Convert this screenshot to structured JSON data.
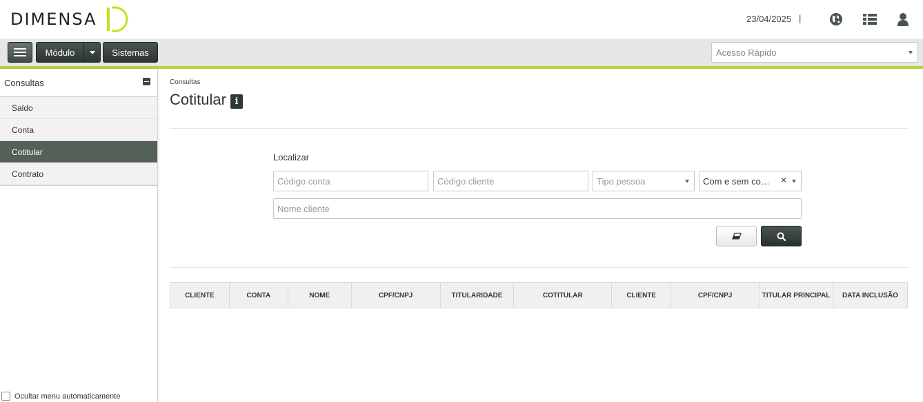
{
  "header": {
    "brand": "Dimensa",
    "date": "23/04/2025",
    "separator": "|",
    "icons": [
      "globe-icon",
      "list-icon",
      "user-icon"
    ]
  },
  "toolbar": {
    "modulo_label": "Módulo",
    "sistemas_label": "Sistemas",
    "acesso_placeholder": "Acesso Rápido"
  },
  "sidebar": {
    "title": "Consultas",
    "items": [
      {
        "label": "Saldo",
        "active": false
      },
      {
        "label": "Conta",
        "active": false
      },
      {
        "label": "Cotitular",
        "active": true
      },
      {
        "label": "Contrato",
        "active": false
      }
    ],
    "footer_label": "Ocultar menu automaticamente"
  },
  "main": {
    "breadcrumb": "Consultas",
    "title": "Cotitular",
    "localizar_label": "Localizar",
    "fields": {
      "codigo_conta_placeholder": "Código conta",
      "codigo_cliente_placeholder": "Código cliente",
      "tipo_pessoa_placeholder": "Tipo pessoa",
      "filtro_value": "Com e sem co…",
      "nome_cliente_placeholder": "Nome cliente"
    },
    "table_headers": [
      "CLIENTE",
      "CONTA",
      "NOME",
      "CPF/CNPJ",
      "TITULARIDADE",
      "COTITULAR",
      "CLIENTE",
      "CPF/CNPJ",
      "TITULAR PRINCIPAL",
      "DATA INCLUSÃO"
    ]
  },
  "colors": {
    "accent": "#b5d334",
    "dark_button": "#2f3a34",
    "sidebar_active": "#536158"
  }
}
